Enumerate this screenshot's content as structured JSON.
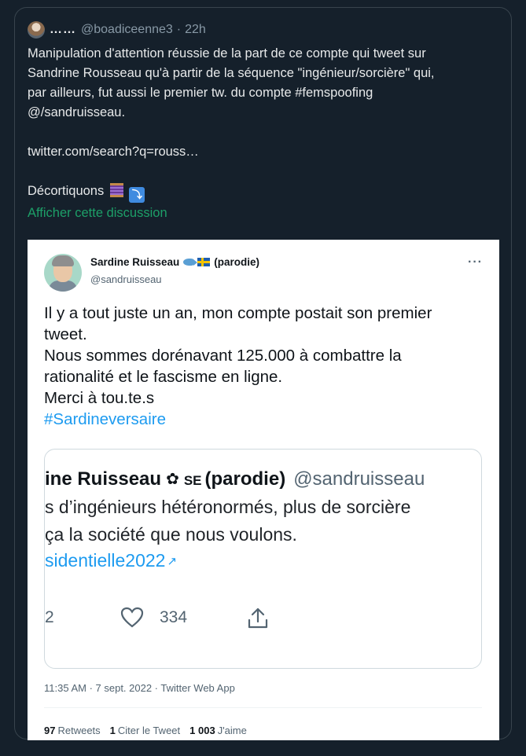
{
  "outer_tweet": {
    "display_name": "……",
    "handle": "@boadiceenne3",
    "separator": "·",
    "time": "22h",
    "text_lines": [
      "Manipulation d'attention réussie de la part de ce compte qui tweet sur",
      "Sandrine Rousseau qu'à partir de la séquence \"ingénieur/sorcière\" qui,",
      "par ailleurs, fut aussi le premier tw. du compte #femspoofing",
      "@/sandruisseau."
    ],
    "link": "twitter.com/search?q=rouss…",
    "closing": "Décortiquons",
    "emoji_thread_icon": "thread-spool-icon",
    "emoji_arrow_icon": "arrow-down-icon",
    "emoji_arrow_glyph": "⤵",
    "show_thread": "Afficher cette discussion"
  },
  "embedded_tweet": {
    "display_name": "Sardine Ruisseau",
    "paren": "(parodie)",
    "handle": "@sandruisseau",
    "more": "···",
    "text_lines": [
      "Il y a tout juste un an, mon compte postait son premier",
      "tweet.",
      "Nous sommes dorénavant 125.000 à combattre la",
      "rationalité et le fascisme en ligne.",
      "Merci à tou.te.s"
    ],
    "hashtag": "#Sardineversaire",
    "quote": {
      "name": "ine Ruisseau",
      "gear": "✿",
      "se": "SE",
      "paren": "(parodie)",
      "handle": "@sandruisseau",
      "line2": "s d’ingénieurs hétéronormés, plus de sorcière",
      "line3": " ça la société que nous voulons.",
      "line4": "sidentielle2022",
      "ext_glyph": "↗",
      "left_count": "2",
      "likes": "334"
    },
    "meta": "11:35 AM · 7 sept. 2022 · Twitter Web App",
    "stats": {
      "retweets_count": "97",
      "retweets_label": "Retweets",
      "quotes_count": "1",
      "quotes_label": "Citer le Tweet",
      "likes_count": "1 003",
      "likes_label": "J'aime"
    }
  },
  "colors": {
    "background": "#15202b",
    "border": "#38444d",
    "link_green": "#1d9f68",
    "hashtag_blue": "#1d9bf0"
  }
}
